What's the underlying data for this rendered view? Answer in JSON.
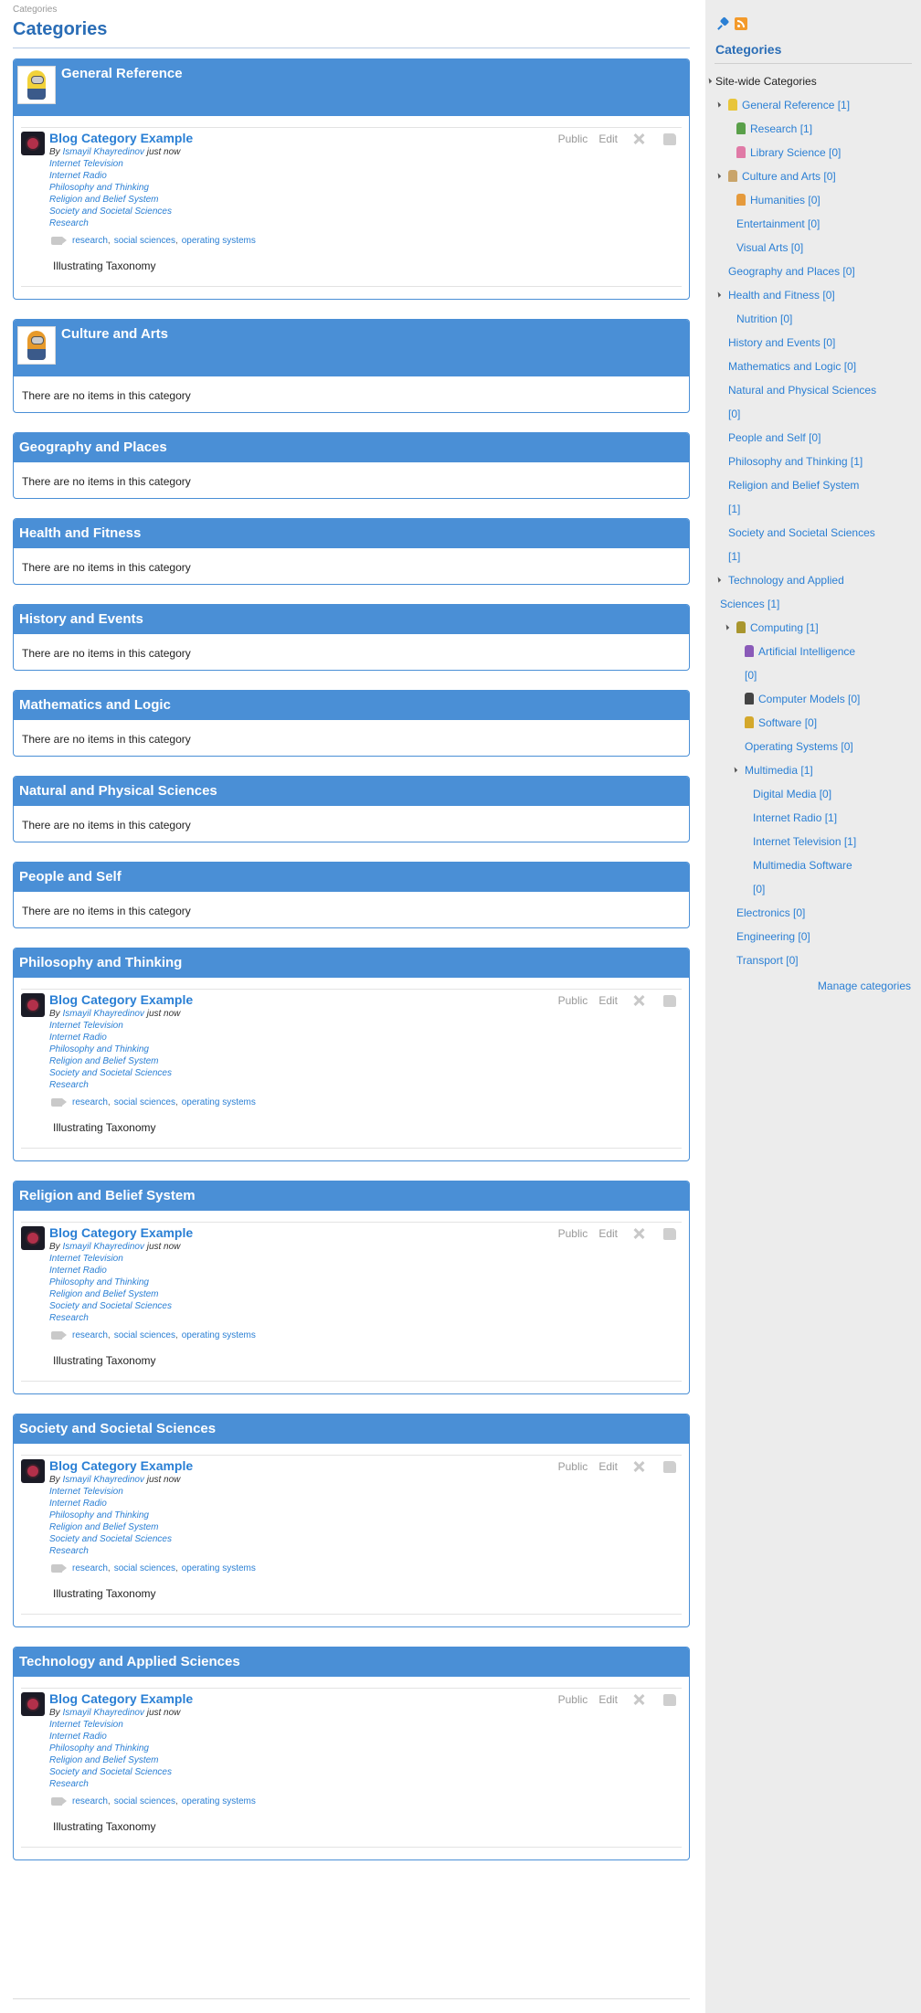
{
  "breadcrumb": "Categories",
  "page_title": "Categories",
  "empty_text": "There are no items in this category",
  "post": {
    "title": "Blog Category Example",
    "by": "By",
    "author": "Ismayil Khayredinov",
    "time": "just now",
    "categories": [
      "Internet Television",
      "Internet Radio",
      "Philosophy and Thinking",
      "Religion and Belief System",
      "Society and Societal Sciences",
      "Research"
    ],
    "tags": [
      "research",
      "social sciences",
      "operating systems"
    ],
    "excerpt": "Illustrating Taxonomy",
    "access": "Public",
    "edit": "Edit"
  },
  "categories": [
    {
      "name": "General Reference",
      "has_post": true,
      "thumb": "yellow-minion"
    },
    {
      "name": "Culture and Arts",
      "has_post": false,
      "thumb": "orange-minion"
    },
    {
      "name": "Geography and Places",
      "has_post": false
    },
    {
      "name": "Health and Fitness",
      "has_post": false
    },
    {
      "name": "History and Events",
      "has_post": false
    },
    {
      "name": "Mathematics and Logic",
      "has_post": false
    },
    {
      "name": "Natural and Physical Sciences",
      "has_post": false
    },
    {
      "name": "People and Self",
      "has_post": false
    },
    {
      "name": "Philosophy and Thinking",
      "has_post": true
    },
    {
      "name": "Religion and Belief System",
      "has_post": true
    },
    {
      "name": "Society and Societal Sciences",
      "has_post": true
    },
    {
      "name": "Technology and Applied Sciences",
      "has_post": true
    }
  ],
  "sidebar": {
    "title": "Categories",
    "tree_root": "Site-wide Categories",
    "tree": [
      {
        "label": "General Reference [1]",
        "depth": 1,
        "expanded": true,
        "icon": "yellow"
      },
      {
        "label": "Research [1]",
        "depth": 2,
        "icon": "green"
      },
      {
        "label": "Library Science [0]",
        "depth": 2,
        "icon": "pink"
      },
      {
        "label": "Culture and Arts [0]",
        "depth": 1,
        "expanded": true,
        "icon": "tan"
      },
      {
        "label": "Humanities [0]",
        "depth": 2,
        "icon": "orange"
      },
      {
        "label": "Entertainment [0]",
        "depth": 2
      },
      {
        "label": "Visual Arts [0]",
        "depth": 2
      },
      {
        "label": "Geography and Places [0]",
        "depth": 1
      },
      {
        "label": "Health and Fitness [0]",
        "depth": 1,
        "expanded": true
      },
      {
        "label": "Nutrition [0]",
        "depth": 2
      },
      {
        "label": "History and Events [0]",
        "depth": 1
      },
      {
        "label": "Mathematics and Logic [0]",
        "depth": 1
      },
      {
        "label": "Natural and Physical Sciences",
        "depth": 1
      },
      {
        "label": "[0]",
        "depth": 1
      },
      {
        "label": "People and Self [0]",
        "depth": 1
      },
      {
        "label": "Philosophy and Thinking [1]",
        "depth": 1
      },
      {
        "label": "Religion and Belief System",
        "depth": 1
      },
      {
        "label": "[1]",
        "depth": 1
      },
      {
        "label": "Society and Societal Sciences",
        "depth": 1
      },
      {
        "label": "[1]",
        "depth": 1
      },
      {
        "label": "Technology and Applied",
        "depth": 1,
        "expanded": true
      },
      {
        "label": "Sciences [1]",
        "depth": 0
      },
      {
        "label": "Computing [1]",
        "depth": 2,
        "expanded": true,
        "icon": "olive"
      },
      {
        "label": "Artificial Intelligence",
        "depth": 3,
        "icon": "purple"
      },
      {
        "label": "[0]",
        "depth": 3
      },
      {
        "label": "Computer Models [0]",
        "depth": 3,
        "icon": "dark"
      },
      {
        "label": "Software [0]",
        "depth": 3,
        "icon": "gold"
      },
      {
        "label": "Operating Systems [0]",
        "depth": 3
      },
      {
        "label": "Multimedia [1]",
        "depth": 3,
        "expanded": true
      },
      {
        "label": "Digital Media [0]",
        "depth": 4
      },
      {
        "label": "Internet Radio [1]",
        "depth": 4
      },
      {
        "label": "Internet Television [1]",
        "depth": 4
      },
      {
        "label": "Multimedia Software",
        "depth": 4
      },
      {
        "label": "[0]",
        "depth": 4
      },
      {
        "label": "Electronics [0]",
        "depth": 2
      },
      {
        "label": "Engineering [0]",
        "depth": 2
      },
      {
        "label": "Transport [0]",
        "depth": 2
      }
    ],
    "manage": "Manage categories"
  },
  "colors": {
    "accent": "#4a8fd6",
    "link": "#2a7fd4",
    "title": "#2a6db6",
    "sidebar_bg": "#ececec"
  }
}
